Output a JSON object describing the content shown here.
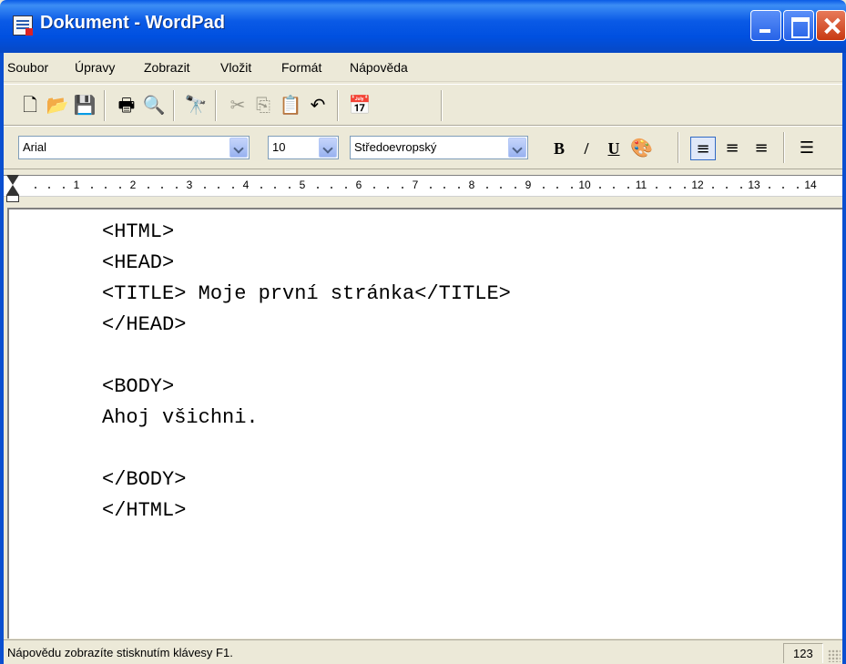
{
  "window": {
    "title": "Dokument - WordPad"
  },
  "menu": {
    "items": [
      {
        "label": "Soubor"
      },
      {
        "label": "Úpravy"
      },
      {
        "label": "Zobrazit"
      },
      {
        "label": "Vložit"
      },
      {
        "label": "Formát"
      },
      {
        "label": "Nápověda"
      }
    ]
  },
  "toolbar": {
    "icons": [
      "new-document-icon",
      "open-folder-icon",
      "save-icon",
      "print-icon",
      "print-preview-icon",
      "find-icon",
      "cut-icon",
      "copy-icon",
      "paste-icon",
      "undo-icon",
      "date-time-icon"
    ]
  },
  "format_bar": {
    "font": "Arial",
    "size": "10",
    "script": "Středoevropský",
    "bold_label": "B",
    "italic_label": "/",
    "underline_label": "U"
  },
  "ruler": {
    "numbers": [
      "1",
      "2",
      "3",
      "4",
      "5",
      "6",
      "7",
      "8",
      "9",
      "10",
      "11",
      "12",
      "13",
      "14"
    ]
  },
  "document": {
    "lines": [
      "<HTML>",
      "<HEAD>",
      "<TITLE> Moje první stránka</TITLE>",
      "</HEAD>",
      "",
      "<BODY>",
      "Ahoj všichni.",
      "",
      "</BODY>",
      "</HTML>"
    ]
  },
  "status": {
    "text": "Nápovědu zobrazíte stisknutím klávesy F1.",
    "panel": "123"
  },
  "colors": {
    "titlebar": "#0a5ae6",
    "chrome": "#ece9d8"
  }
}
